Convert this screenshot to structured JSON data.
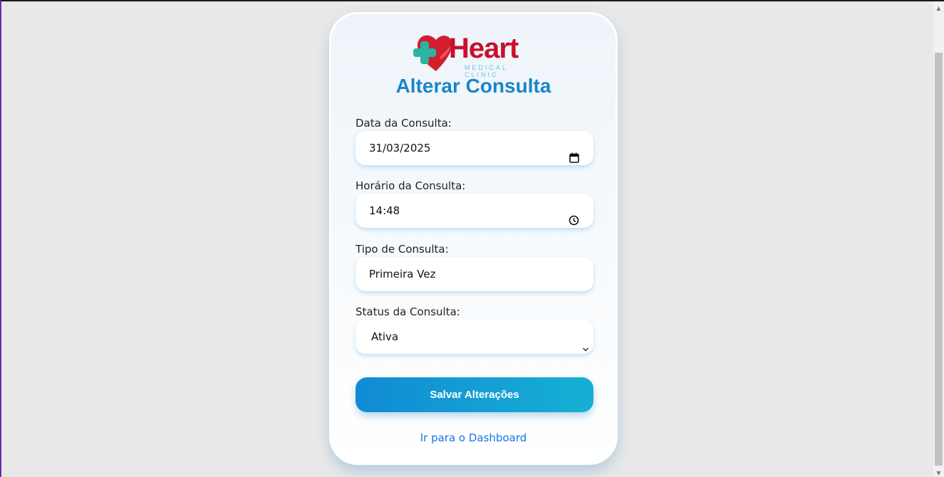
{
  "brand": {
    "name": "Heart",
    "tagline": "MEDICAL CLINIC",
    "colors": {
      "red": "#c8102e",
      "teal": "#2bb3a3",
      "light_blue": "#6fc3df"
    }
  },
  "page": {
    "title": "Alterar Consulta",
    "accent": "#1a86c8"
  },
  "form": {
    "date": {
      "label": "Data da Consulta:",
      "value": "31/03/2025",
      "icon": "calendar-icon"
    },
    "time": {
      "label": "Horário da Consulta:",
      "value": "14:48",
      "icon": "clock-icon"
    },
    "type": {
      "label": "Tipo de Consulta:",
      "value": "Primeira Vez"
    },
    "status": {
      "label": "Status da Consulta:",
      "value": "Ativa",
      "icon": "chevron-down-icon"
    }
  },
  "actions": {
    "save_label": "Salvar Alterações",
    "dashboard_link": "Ir para o Dashboard"
  }
}
